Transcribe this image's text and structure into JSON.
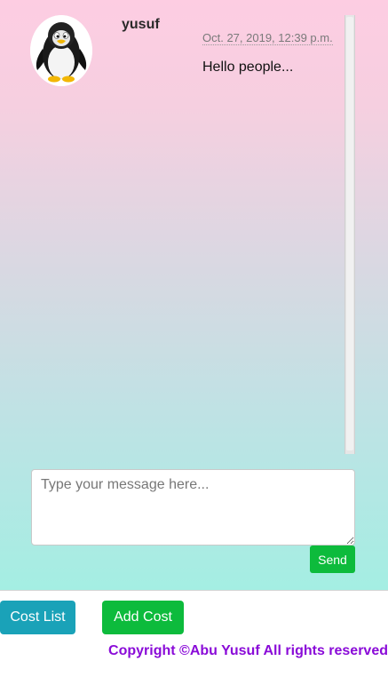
{
  "chat": {
    "messages": [
      {
        "username": "yusuf",
        "timestamp": "Oct. 27, 2019, 12:39 p.m.",
        "text": "Hello people...",
        "avatar_icon": "penguin-icon"
      }
    ],
    "input_placeholder": "Type your message here...",
    "input_value": "",
    "send_label": "Send"
  },
  "nav": {
    "cost_list_label": "Cost List",
    "add_cost_label": "Add Cost"
  },
  "footer": {
    "copyright": "Copyright ©Abu Yusuf All rights reserved"
  },
  "colors": {
    "gradient_top": "#fdcde2",
    "gradient_bottom": "#a4eee3",
    "send_button": "#0dbb3c",
    "cost_list_button": "#1aa2b8",
    "add_cost_button": "#0dbb3c",
    "copyright_text": "#8a0bd8"
  }
}
